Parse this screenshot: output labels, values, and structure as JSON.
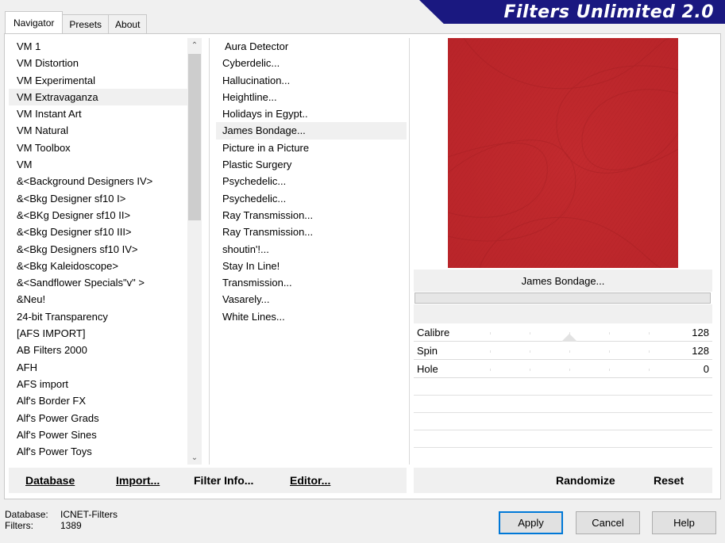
{
  "tabs": [
    "Navigator",
    "Presets",
    "About"
  ],
  "banner_title": "Filters Unlimited 2.0",
  "categories": [
    "VM 1",
    "VM Distortion",
    "VM Experimental",
    "VM Extravaganza",
    "VM Instant Art",
    "VM Natural",
    "VM Toolbox",
    "VM",
    "&<Background Designers IV>",
    "&<Bkg Designer sf10 I>",
    "&<BKg Designer sf10 II>",
    "&<Bkg Designer sf10 III>",
    "&<Bkg Designers sf10 IV>",
    "&<Bkg Kaleidoscope>",
    "&<Sandflower Specials\"v\" >",
    "&Neu!",
    "24-bit Transparency",
    "[AFS IMPORT]",
    "AB Filters 2000",
    "AFH",
    "AFS import",
    "Alf's Border FX",
    "Alf's Power Grads",
    "Alf's Power Sines",
    "Alf's Power Toys"
  ],
  "selected_category": "VM Extravaganza",
  "filters": [
    "Aura Detector",
    "Cyberdelic...",
    "Hallucination...",
    "Heightline...",
    "Holidays in Egypt..",
    "James Bondage...",
    "Picture in a Picture",
    "Plastic Surgery",
    "Psychedelic...",
    "Psychedelic...",
    "Ray Transmission...",
    "Ray Transmission...",
    "shoutin'!...",
    "Stay In Line!",
    "Transmission...",
    "Vasarely...",
    "White Lines..."
  ],
  "selected_filter": "James Bondage...",
  "preview": {
    "color": "#c42a2e",
    "filter_name": "James Bondage...",
    "progress": 0
  },
  "params": [
    {
      "label": "Calibre",
      "value": "128",
      "level": 0.5
    },
    {
      "label": "Spin",
      "value": "128",
      "level": 0.5
    },
    {
      "label": "Hole",
      "value": "0",
      "level": 0.5
    }
  ],
  "left_toolbar": {
    "database": "Database",
    "import": "Import...",
    "filter_info": "Filter Info...",
    "editor": "Editor..."
  },
  "right_toolbar": {
    "randomize": "Randomize",
    "reset": "Reset"
  },
  "status": {
    "database_key": "Database:",
    "database_value": "ICNET-Filters",
    "filters_key": "Filters:",
    "filters_value": "1389"
  },
  "buttons": {
    "apply": "Apply",
    "cancel": "Cancel",
    "help": "Help"
  },
  "icons": {
    "scroll_up": "chevron-up-icon",
    "scroll_down": "chevron-down-icon"
  }
}
